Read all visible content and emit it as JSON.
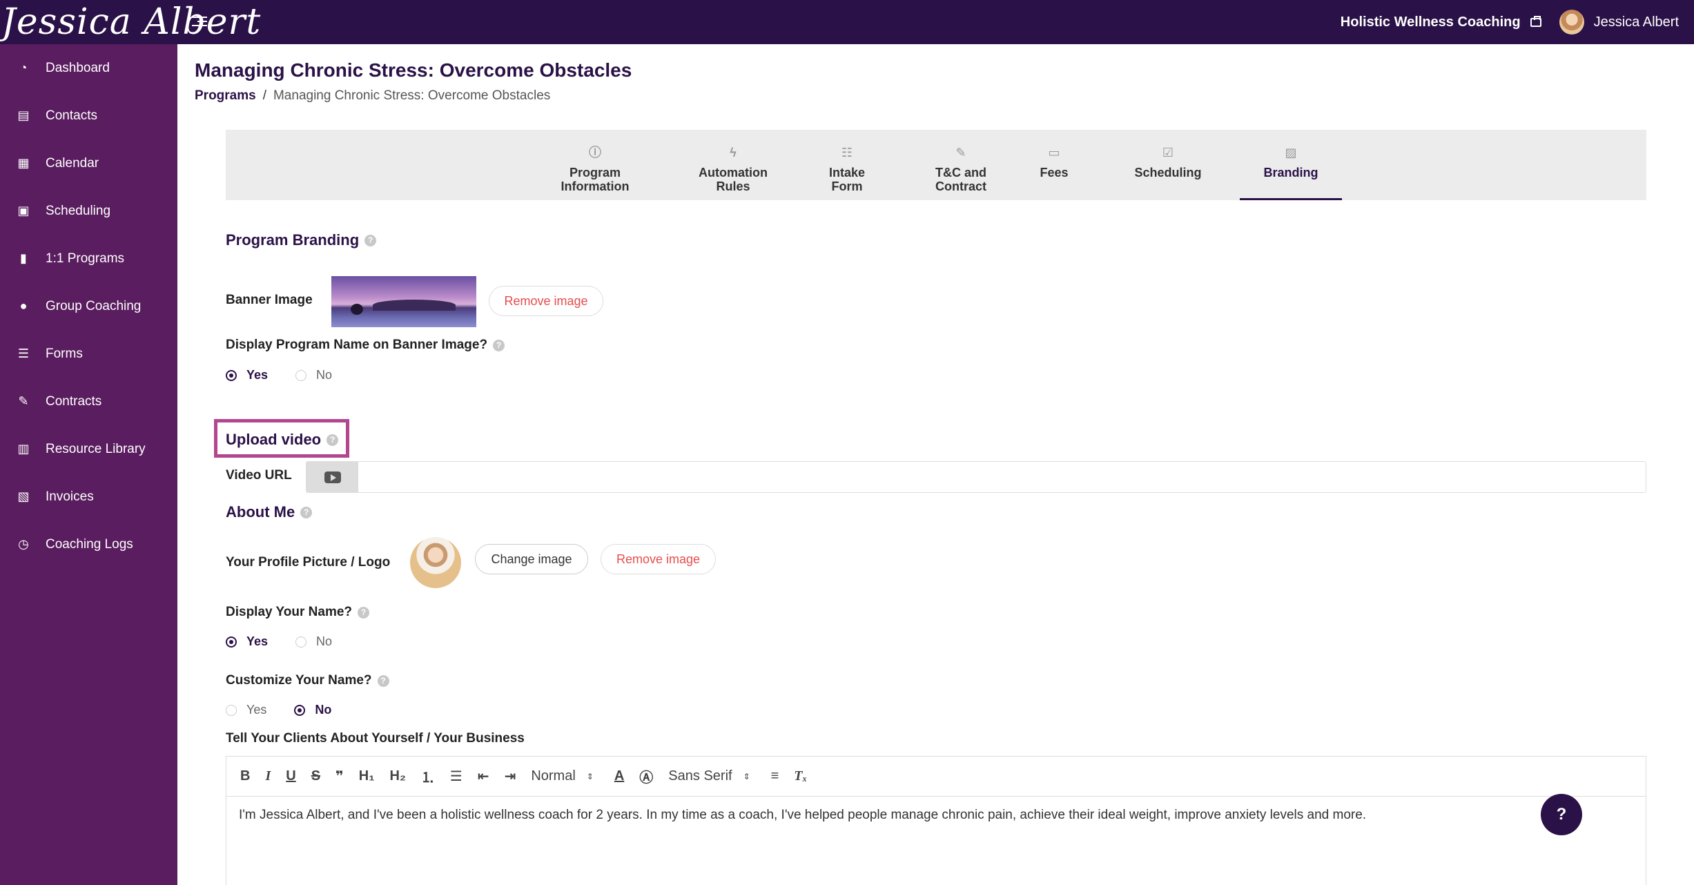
{
  "header": {
    "brand": "Jessica Albert",
    "company": "Holistic Wellness Coaching",
    "user_name": "Jessica Albert"
  },
  "sidebar": {
    "items": [
      {
        "label": "Dashboard",
        "icon": "dashboard-icon"
      },
      {
        "label": "Contacts",
        "icon": "contacts-icon"
      },
      {
        "label": "Calendar",
        "icon": "calendar-icon"
      },
      {
        "label": "Scheduling",
        "icon": "scheduling-icon"
      },
      {
        "label": "1:1 Programs",
        "icon": "book-icon"
      },
      {
        "label": "Group Coaching",
        "icon": "group-icon"
      },
      {
        "label": "Forms",
        "icon": "forms-icon"
      },
      {
        "label": "Contracts",
        "icon": "contract-icon"
      },
      {
        "label": "Resource Library",
        "icon": "library-icon"
      },
      {
        "label": "Invoices",
        "icon": "invoice-icon"
      },
      {
        "label": "Coaching Logs",
        "icon": "clock-icon"
      }
    ]
  },
  "page": {
    "title": "Managing Chronic Stress: Overcome Obstacles",
    "breadcrumb_link": "Programs",
    "breadcrumb_sep": "/",
    "breadcrumb_current": "Managing Chronic Stress: Overcome Obstacles"
  },
  "tabs": [
    {
      "line1": "Program",
      "line2": "Information",
      "icon": "info-icon"
    },
    {
      "line1": "Automation",
      "line2": "Rules",
      "icon": "lightning-icon"
    },
    {
      "line1": "Intake",
      "line2": "Form",
      "icon": "checklist-icon"
    },
    {
      "line1": "T&C and",
      "line2": "Contract",
      "icon": "contract-edit-icon"
    },
    {
      "line1": "Fees",
      "line2": "",
      "icon": "card-icon"
    },
    {
      "line1": "Scheduling",
      "line2": "",
      "icon": "calendar-check-icon"
    },
    {
      "line1": "Branding",
      "line2": "",
      "icon": "image-icon",
      "active": true
    }
  ],
  "branding": {
    "section_title": "Program Branding",
    "banner_label": "Banner Image",
    "remove_image": "Remove image",
    "display_name_question": "Display Program Name on Banner Image?",
    "yes": "Yes",
    "no": "No"
  },
  "video": {
    "section_title": "Upload video",
    "url_label": "Video URL",
    "url_value": ""
  },
  "about": {
    "section_title": "About Me",
    "profile_label": "Your Profile Picture / Logo",
    "change_image": "Change image",
    "remove_image": "Remove image",
    "display_your_name": "Display Your Name?",
    "customize_your_name": "Customize Your Name?",
    "tell_clients": "Tell Your Clients About Yourself / Your Business"
  },
  "editor": {
    "header_select": "Normal",
    "font_select": "Sans Serif",
    "content": "I'm Jessica Albert, and I've been a holistic wellness coach for 2 years. In my time as a coach, I've helped people manage chronic pain, achieve their ideal weight, improve anxiety levels and more."
  },
  "help_button": "?",
  "colors": {
    "topbar": "#2a1147",
    "sidebar": "#5a1d5f",
    "accent": "#2a1147",
    "danger": "#e74c4c",
    "highlight": "#b3478f"
  }
}
